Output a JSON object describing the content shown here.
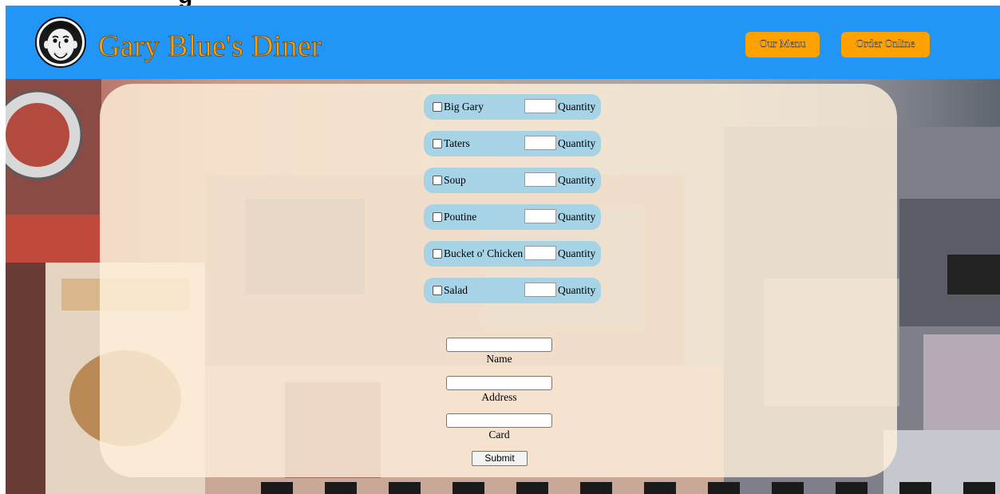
{
  "site": {
    "title": "Gary Blue's Diner",
    "partial_heading": "g"
  },
  "nav": {
    "menu_label": "Our Menu",
    "order_label": "Order Online"
  },
  "order": {
    "quantity_label": "Quantity",
    "items": [
      {
        "name": "Big Gary",
        "checked": false,
        "quantity": ""
      },
      {
        "name": "Taters",
        "checked": false,
        "quantity": ""
      },
      {
        "name": "Soup",
        "checked": false,
        "quantity": ""
      },
      {
        "name": "Poutine",
        "checked": false,
        "quantity": ""
      },
      {
        "name": "Bucket o' Chicken",
        "checked": false,
        "quantity": ""
      },
      {
        "name": "Salad",
        "checked": false,
        "quantity": ""
      }
    ]
  },
  "customer": {
    "name_label": "Name",
    "name_value": "",
    "address_label": "Address",
    "address_value": "",
    "card_label": "Card",
    "card_value": ""
  },
  "submit_label": "Submit",
  "colors": {
    "header": "#2196f6",
    "title": "#f8a116",
    "nav_button": "#ffa200",
    "item_row": "#a6d4e6"
  }
}
